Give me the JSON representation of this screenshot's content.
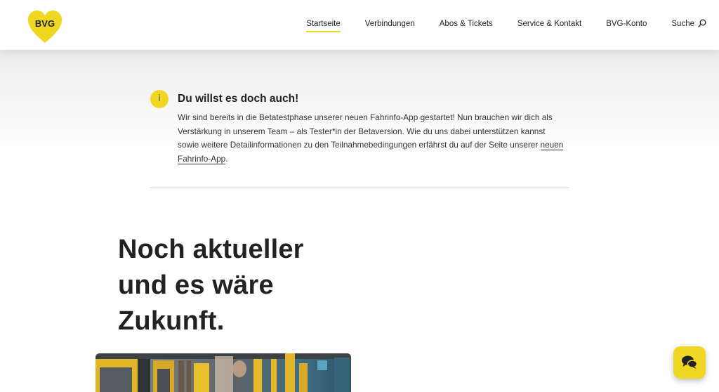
{
  "brand": {
    "logo_text": "BVG",
    "accent_color": "#f0d722"
  },
  "nav": {
    "items": [
      {
        "label": "Startseite",
        "active": true
      },
      {
        "label": "Verbindungen",
        "active": false
      },
      {
        "label": "Abos & Tickets",
        "active": false
      },
      {
        "label": "Service & Kontakt",
        "active": false
      },
      {
        "label": "BVG-Konto",
        "active": false
      }
    ],
    "search_label": "Suche",
    "search_icon": "search-icon"
  },
  "notice": {
    "icon": "info-icon",
    "icon_glyph": "i",
    "title": "Du willst es doch auch!",
    "body": "Wir sind bereits in die Betatestphase unserer neuen Fahrinfo-App gestartet! Nun brauchen wir dich als Verstärkung in unserem Team – als Tester*in der Betaversion. Wie du uns dabei unterstützen kannst sowie weitere Detailinformationen zu den Teilnahmebedingungen erfährst du auf der Seite unserer",
    "link_text": "neuen Fahrinfo-App",
    "body_end": "."
  },
  "headline": {
    "line1": "Noch aktueller",
    "line2": "und es wäre",
    "line3": "Zukunft."
  },
  "chat": {
    "icon": "chat-icon"
  }
}
